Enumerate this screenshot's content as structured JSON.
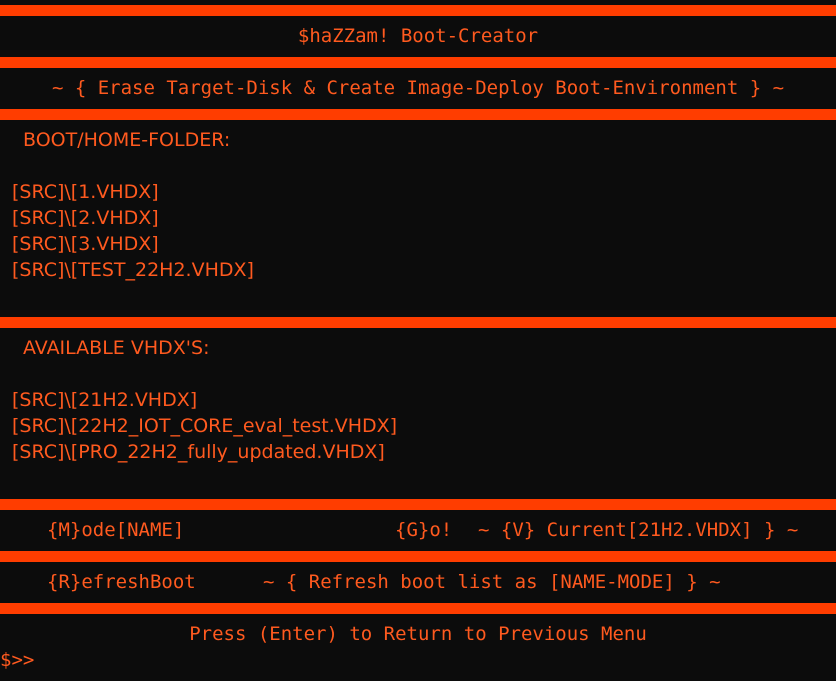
{
  "header": {
    "title": "$haZZam! Boot-Creator",
    "subtitle": "~ { Erase Target-Disk & Create Image-Deploy Boot-Environment } ~"
  },
  "boot_section": {
    "heading": "BOOT/HOME-FOLDER:",
    "items": [
      "[SRC]\\[1.VHDX]",
      "[SRC]\\[2.VHDX]",
      "[SRC]\\[3.VHDX]",
      "[SRC]\\[TEST_22H2.VHDX]"
    ]
  },
  "available_section": {
    "heading": "AVAILABLE VHDX'S:",
    "items": [
      "[SRC]\\[21H2.VHDX]",
      "[SRC]\\[22H2_IOT_CORE_eval_test.VHDX]",
      "[SRC]\\[PRO_22H2_fully_updated.VHDX]"
    ]
  },
  "menu": {
    "mode": "{M}ode[NAME]",
    "go": "{G}o!",
    "current": "~ {V} Current[21H2.VHDX] } ~",
    "refresh": "{R}efreshBoot",
    "refresh_desc": "~ { Refresh boot list as [NAME-MODE] } ~"
  },
  "footer": {
    "prompt_msg": "Press (Enter) to Return to Previous Menu",
    "shell_prompt": "$>>"
  },
  "colors": {
    "background": "#0c0c0c",
    "bar": "#ff3d00",
    "text": "#ff5a1f"
  }
}
